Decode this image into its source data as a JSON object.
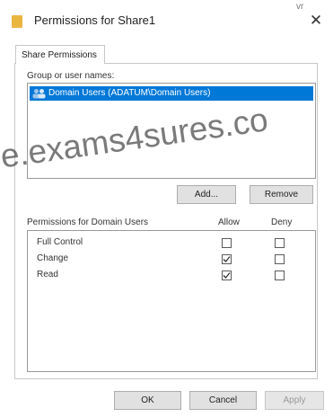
{
  "window": {
    "title": "Permissions for Share1",
    "corner_mark": "vr"
  },
  "tabs": [
    {
      "label": "Share Permissions"
    }
  ],
  "group": {
    "label": "Group or user names:",
    "items": [
      {
        "name": "Domain Users (ADATUM\\Domain Users)",
        "selected": true
      }
    ]
  },
  "buttons": {
    "add": "Add...",
    "remove": "Remove",
    "ok": "OK",
    "cancel": "Cancel",
    "apply": "Apply"
  },
  "permissions": {
    "label": "Permissions for Domain Users",
    "col_allow": "Allow",
    "col_deny": "Deny",
    "rows": [
      {
        "name": "Full Control",
        "allow": false,
        "deny": false
      },
      {
        "name": "Change",
        "allow": true,
        "deny": false
      },
      {
        "name": "Read",
        "allow": true,
        "deny": false
      }
    ]
  },
  "watermark": "e.exams4sures.co",
  "colors": {
    "selection": "#0078d7",
    "folder_icon": "#e9b640"
  }
}
